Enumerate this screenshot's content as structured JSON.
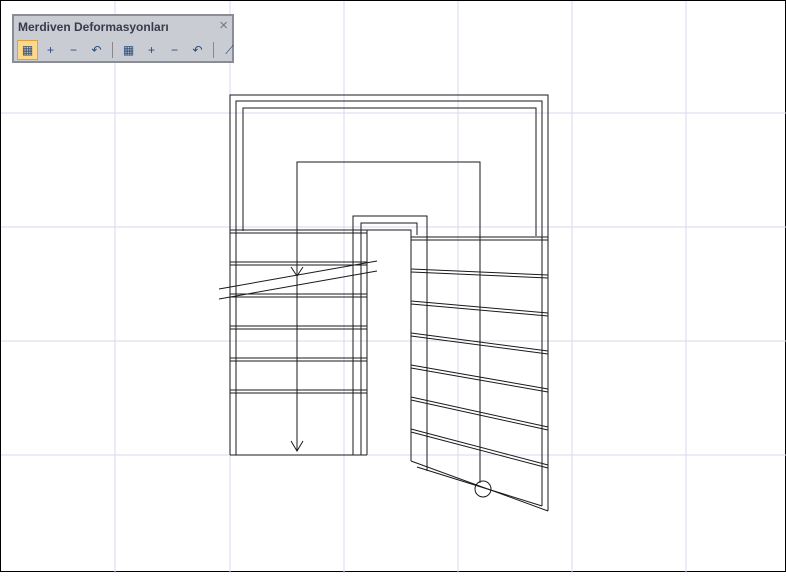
{
  "toolbar": {
    "title": "Merdiven Deformasyonları",
    "close": "×",
    "buttons": [
      {
        "icon": "stair-select-icon",
        "glyph": "▦"
      },
      {
        "icon": "add-point-icon",
        "glyph": "+"
      },
      {
        "icon": "remove-point-icon",
        "glyph": "−"
      },
      {
        "icon": "undo-deform-icon",
        "glyph": "↶"
      },
      {
        "icon": "stair-select-2-icon",
        "glyph": "▦"
      },
      {
        "icon": "add-point-2-icon",
        "glyph": "+"
      },
      {
        "icon": "remove-point-2-icon",
        "glyph": "−"
      },
      {
        "icon": "undo-deform-2-icon",
        "glyph": "↶"
      },
      {
        "icon": "stair-icon",
        "glyph": "⟋"
      }
    ]
  },
  "colors": {
    "grid": "#d8d8ec",
    "line": "#1a1a1a",
    "active": "#fbd88a"
  }
}
